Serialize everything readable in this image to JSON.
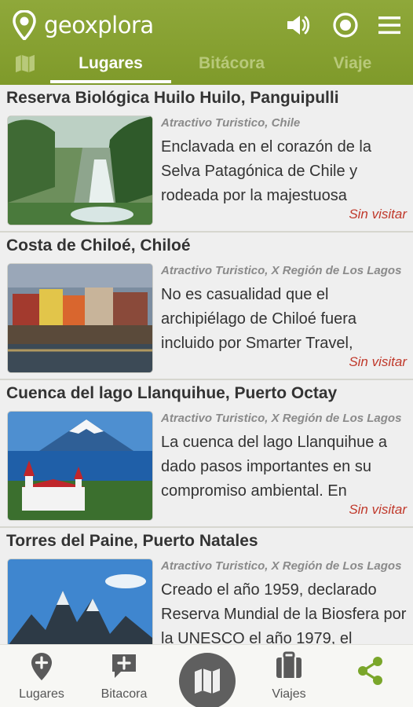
{
  "app": {
    "name": "geoxplora"
  },
  "header_icons": [
    "map-pin-icon",
    "volume-icon",
    "record-icon",
    "menu-icon"
  ],
  "tabs": [
    {
      "label": "",
      "icon": "map-icon",
      "active": false
    },
    {
      "label": "Lugares",
      "active": true
    },
    {
      "label": "Bitácora",
      "active": false
    },
    {
      "label": "Viaje",
      "active": false
    }
  ],
  "places": [
    {
      "title": "Reserva Biológica Huilo Huilo, Panguipulli",
      "category": "Atractivo Turistico, Chile",
      "description": "Enclavada en el corazón de la Selva Patagónica de Chile y rodeada por la majestuosa",
      "status": "Sin visitar"
    },
    {
      "title": "Costa de Chiloé, Chiloé",
      "category": "Atractivo Turistico, X Región de Los Lagos",
      "description": "No es casualidad que el archipiélago de Chiloé fuera incluido por Smarter Travel,",
      "status": "Sin visitar"
    },
    {
      "title": "Cuenca del lago Llanquihue, Puerto Octay",
      "category": "Atractivo Turistico, X Región de Los Lagos",
      "description": "La cuenca del lago Llanquihue a dado pasos importantes en su compromiso ambiental. En",
      "status": "Sin visitar"
    },
    {
      "title": "Torres del Paine, Puerto Natales",
      "category": "Atractivo Turistico, X Región de Los Lagos",
      "description": "Creado el año 1959, declarado Reserva Mundial de la Biosfera por la UNESCO el año 1979, el",
      "status": ""
    }
  ],
  "bottom_nav": {
    "lugares": "Lugares",
    "bitacora": "Bitacora",
    "viajes": "Viajes"
  },
  "colors": {
    "brand_green": "#86a232",
    "status_red": "#c0392b",
    "share_green": "#7aa62a"
  }
}
